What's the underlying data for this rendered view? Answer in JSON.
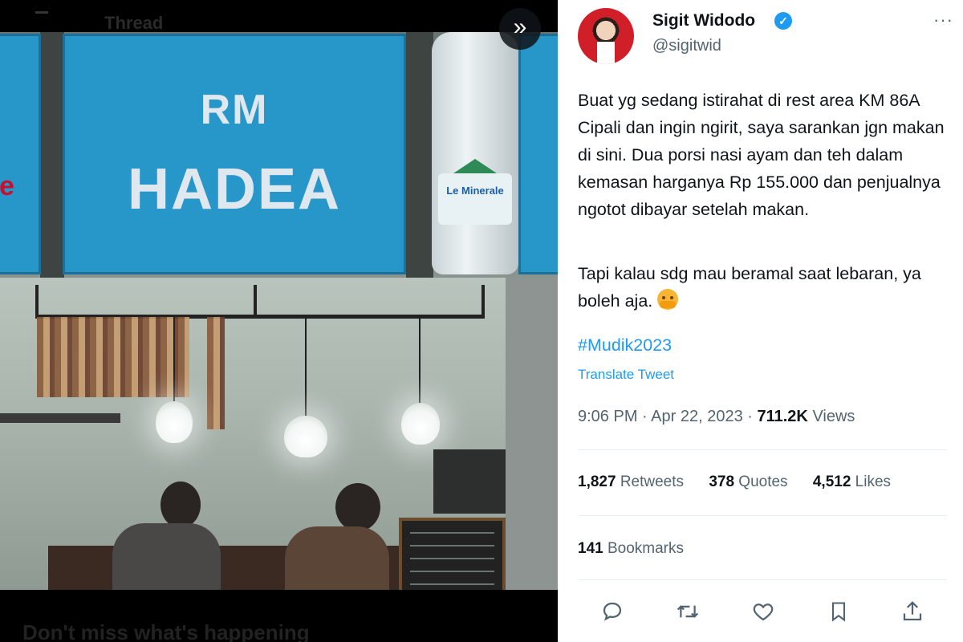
{
  "viewer": {
    "topbar_title": "Thread",
    "bottom_ghost_text": "Don't miss what's happening",
    "photo": {
      "sign_line1": "RM",
      "sign_line2": "HADEA",
      "left_sign_fragment": "e",
      "bottle_label": "Le Minerale"
    }
  },
  "tweet": {
    "author_name": "Sigit Widodo",
    "author_handle": "@sigitwid",
    "body_paragraph_1": "Buat yg sedang istirahat di rest area KM 86A Cipali dan ingin ngirit, saya sarankan jgn makan di sini. Dua porsi nasi ayam dan teh dalam kemasan harganya Rp 155.000 dan penjualnya ngotot dibayar setelah makan.",
    "body_paragraph_2": "Tapi kalau sdg mau beramal saat lebaran, ya boleh aja.",
    "hashtag": "#Mudik2023",
    "translate_label": "Translate Tweet",
    "time": "9:06 PM",
    "date": "Apr 22, 2023",
    "views_count": "711.2K",
    "views_label": "Views",
    "retweets_count": "1,827",
    "retweets_label": "Retweets",
    "quotes_count": "378",
    "quotes_label": "Quotes",
    "likes_count": "4,512",
    "likes_label": "Likes",
    "bookmarks_count": "141",
    "bookmarks_label": "Bookmarks"
  },
  "icons": {
    "expand": "double-chevron-right-icon",
    "verified": "verified-badge-icon",
    "more": "more-dots-icon",
    "reply": "reply-icon",
    "retweet": "retweet-icon",
    "like": "heart-icon",
    "bookmark": "bookmark-icon",
    "share": "share-icon"
  },
  "colors": {
    "link_blue": "#1d9bf0",
    "text_primary": "#0f1419",
    "text_secondary": "#536471",
    "sign_blue": "#2796c9"
  }
}
